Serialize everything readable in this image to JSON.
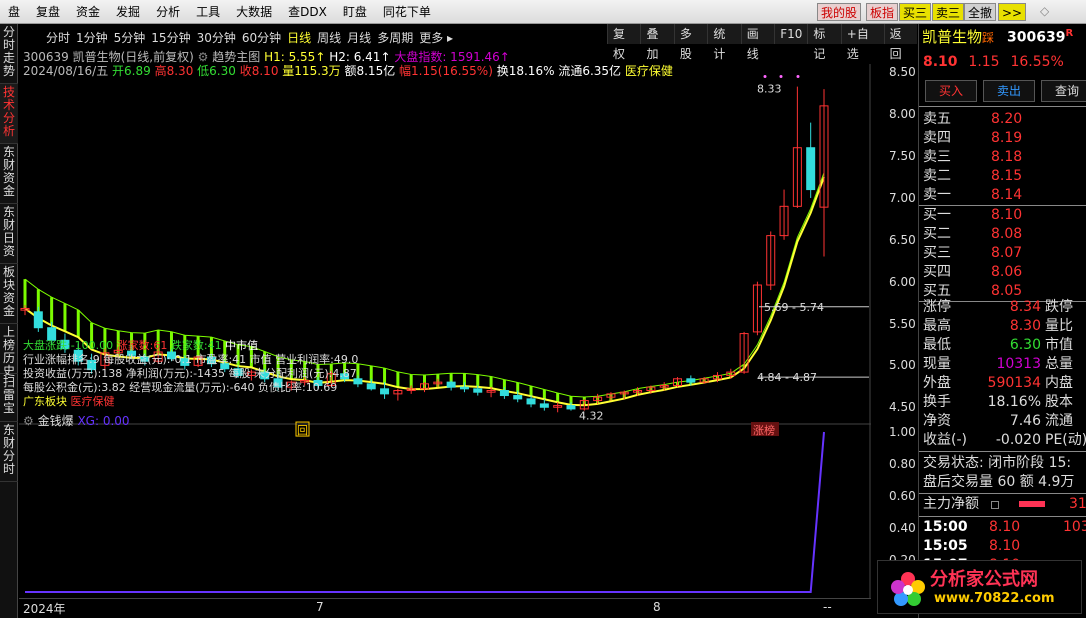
{
  "menubar": {
    "items": [
      "盘",
      "复盘",
      "资金",
      "发掘",
      "分析",
      "工具",
      "大数据",
      "查DDX",
      "盯盘",
      "同花下单"
    ],
    "quick": [
      "我的股",
      "板指",
      "买三",
      "卖三",
      "全撤",
      ">>"
    ]
  },
  "left_tabs": [
    "分时走势",
    "技术分析",
    "东财资金",
    "东财日资",
    "板块资金",
    "上榜历史",
    "扫雷宝",
    "东财分时"
  ],
  "chart_toolbar": [
    "复权",
    "叠加",
    "多股",
    "统计",
    "画线",
    "F10",
    "标记",
    "+自选",
    "返回"
  ],
  "periods": [
    "分时",
    "1分钟",
    "5分钟",
    "15分钟",
    "30分钟",
    "60分钟",
    "日线",
    "周线",
    "月线",
    "多周期",
    "更多 ▸"
  ],
  "active_period": "日线",
  "stock_title": {
    "code_name": "300639 凯普生物(日线,前复权)",
    "indicator": "趋势主图",
    "h1": "H1: 5.55↑",
    "h2": "H2: 6.41↑",
    "index": "大盘指数: 1591.46↑"
  },
  "stock_info": {
    "date": "2024/08/16/五",
    "open": "开6.89",
    "high": "高8.30",
    "low": "低6.30",
    "close": "收8.10",
    "vol": "量115.3万",
    "amount": "额8.15亿",
    "change": "幅1.15(16.55%)",
    "turnover": "换18.16%",
    "float": "流通6.35亿",
    "sector": "医疗保健"
  },
  "overlay": {
    "line1": "大盘涨跌:-100.00",
    "line1b": "涨家数:61",
    "line1c": "跌家数:41",
    "line1d": "中市值",
    "line2": "行业涨幅排名:9 每股收益(元):-0.1 市盈率:41 市值 营业利润率:49.0",
    "line3": "投资收益(万元):138 净利润(万元):-1435 每股 未分配利润(元):4.87",
    "line4": "每股公积金(元):3.82 经营现金流量(万元):-640 负债比率:10.69",
    "line5": "广东板块",
    "line5b": "医疗保健"
  },
  "annotations": {
    "high_label": "8.33",
    "mid_label": "5.69 - 5.74",
    "low_label": "4.84 - 4.87",
    "min_label": "4.32",
    "zt_label": "涨榜",
    "hui_label": "回"
  },
  "price_axis": [
    "8.50",
    "8.00",
    "7.50",
    "7.00",
    "6.50",
    "6.00",
    "5.50",
    "5.00",
    "4.50"
  ],
  "sub_chart": {
    "name": "金钱爆",
    "value": "XG: 0.00",
    "axis": [
      "1.00",
      "0.80",
      "0.60",
      "0.40",
      "0.20"
    ]
  },
  "time_axis": [
    "2024年",
    "7",
    "8",
    "--"
  ],
  "right_panel": {
    "name": "凯普生物",
    "tag": "踩",
    "code": "300639",
    "code_tag": "R",
    "price": "8.10",
    "change": "1.15",
    "pct": "16.55%",
    "buttons": [
      "买入",
      "卖出",
      "查询"
    ],
    "sells": [
      {
        "label": "卖五",
        "price": "8.20"
      },
      {
        "label": "卖四",
        "price": "8.19"
      },
      {
        "label": "卖三",
        "price": "8.18"
      },
      {
        "label": "卖二",
        "price": "8.15"
      },
      {
        "label": "卖一",
        "price": "8.14"
      }
    ],
    "buys": [
      {
        "label": "买一",
        "price": "8.10"
      },
      {
        "label": "买二",
        "price": "8.08"
      },
      {
        "label": "买三",
        "price": "8.07"
      },
      {
        "label": "买四",
        "price": "8.06"
      },
      {
        "label": "买五",
        "price": "8.05"
      }
    ],
    "stats": [
      {
        "l": "涨停",
        "v": "8.34",
        "c": "#ff3333",
        "l2": "跌停"
      },
      {
        "l": "最高",
        "v": "8.30",
        "c": "#ff3333",
        "l2": "量比"
      },
      {
        "l": "最低",
        "v": "6.30",
        "c": "#33dd33",
        "l2": "市值"
      },
      {
        "l": "现量",
        "v": "10313",
        "c": "#d000d0",
        "l2": "总量"
      },
      {
        "l": "外盘",
        "v": "590134",
        "c": "#ff3333",
        "l2": "内盘"
      },
      {
        "l": "换手",
        "v": "18.16%",
        "c": "#ddd",
        "l2": "股本"
      },
      {
        "l": "净资",
        "v": "7.46",
        "c": "#ddd",
        "l2": "流通"
      },
      {
        "l": "收益(-)",
        "v": "-0.020",
        "c": "#ddd",
        "l2": "PE(动)"
      }
    ],
    "trade_state": "交易状态: 闭市阶段 15:",
    "after_trade": "盘后交易量 60 额 4.9万",
    "main_flow": "主力净额",
    "main_flow_val": "31",
    "ticks": [
      {
        "t": "15:00",
        "p": "8.10",
        "v": "103"
      },
      {
        "t": "15:05",
        "p": "8.10",
        "v": ""
      },
      {
        "t": "15:07",
        "p": "8.10",
        "v": ""
      }
    ]
  },
  "watermark": {
    "title": "分析家公式网",
    "url": "www.70822.com"
  },
  "colors": {
    "up": "#ff3333",
    "down": "#33dddd",
    "ma_yellow": "#ffff33",
    "band_green": "#7cfc00",
    "sub_line": "#6633ff"
  },
  "chart_data": {
    "type": "candlestick",
    "ylim": [
      4.3,
      8.6
    ],
    "candles": [
      [
        5.66,
        5.72,
        5.6,
        5.68
      ],
      [
        5.64,
        5.7,
        5.4,
        5.45
      ],
      [
        5.45,
        5.52,
        5.25,
        5.3
      ],
      [
        5.3,
        5.38,
        5.15,
        5.2
      ],
      [
        5.18,
        5.26,
        5.0,
        5.05
      ],
      [
        5.06,
        5.14,
        4.9,
        4.95
      ],
      [
        5.0,
        5.2,
        4.95,
        5.15
      ],
      [
        5.15,
        5.22,
        5.1,
        5.18
      ],
      [
        5.17,
        5.24,
        5.08,
        5.12
      ],
      [
        5.1,
        5.14,
        5.0,
        5.05
      ],
      [
        5.05,
        5.2,
        5.02,
        5.16
      ],
      [
        5.16,
        5.2,
        5.05,
        5.08
      ],
      [
        5.08,
        5.12,
        4.95,
        5.0
      ],
      [
        5.0,
        5.12,
        4.98,
        5.1
      ],
      [
        5.1,
        5.14,
        4.98,
        5.02
      ],
      [
        5.02,
        5.06,
        4.92,
        4.96
      ],
      [
        4.96,
        5.0,
        4.85,
        4.88
      ],
      [
        4.88,
        4.95,
        4.82,
        4.92
      ],
      [
        4.92,
        4.96,
        4.8,
        4.84
      ],
      [
        4.84,
        4.9,
        4.7,
        4.74
      ],
      [
        4.74,
        4.82,
        4.7,
        4.8
      ],
      [
        4.8,
        4.86,
        4.76,
        4.82
      ],
      [
        4.82,
        4.86,
        4.72,
        4.76
      ],
      [
        4.76,
        4.94,
        4.74,
        4.9
      ],
      [
        4.9,
        4.94,
        4.8,
        4.84
      ],
      [
        4.84,
        4.88,
        4.74,
        4.78
      ],
      [
        4.78,
        4.84,
        4.7,
        4.72
      ],
      [
        4.72,
        4.8,
        4.6,
        4.66
      ],
      [
        4.66,
        4.72,
        4.58,
        4.7
      ],
      [
        4.7,
        4.76,
        4.66,
        4.72
      ],
      [
        4.72,
        4.8,
        4.68,
        4.78
      ],
      [
        4.78,
        4.84,
        4.74,
        4.8
      ],
      [
        4.8,
        4.82,
        4.7,
        4.74
      ],
      [
        4.74,
        4.8,
        4.68,
        4.72
      ],
      [
        4.72,
        4.76,
        4.64,
        4.68
      ],
      [
        4.68,
        4.74,
        4.62,
        4.7
      ],
      [
        4.7,
        4.74,
        4.6,
        4.64
      ],
      [
        4.64,
        4.7,
        4.56,
        4.6
      ],
      [
        4.6,
        4.64,
        4.5,
        4.54
      ],
      [
        4.54,
        4.6,
        4.46,
        4.5
      ],
      [
        4.5,
        4.56,
        4.44,
        4.52
      ],
      [
        4.52,
        4.56,
        4.46,
        4.48
      ],
      [
        4.48,
        4.6,
        4.46,
        4.58
      ],
      [
        4.58,
        4.66,
        4.54,
        4.62
      ],
      [
        4.62,
        4.68,
        4.58,
        4.66
      ],
      [
        4.66,
        4.7,
        4.6,
        4.68
      ],
      [
        4.68,
        4.74,
        4.64,
        4.7
      ],
      [
        4.7,
        4.76,
        4.66,
        4.74
      ],
      [
        4.74,
        4.8,
        4.7,
        4.76
      ],
      [
        4.76,
        4.86,
        4.74,
        4.84
      ],
      [
        4.84,
        4.88,
        4.76,
        4.8
      ],
      [
        4.8,
        4.86,
        4.78,
        4.84
      ],
      [
        4.84,
        4.92,
        4.8,
        4.88
      ],
      [
        4.88,
        4.96,
        4.84,
        4.92
      ],
      [
        4.92,
        5.4,
        4.9,
        5.38
      ],
      [
        5.4,
        6.0,
        5.36,
        5.96
      ],
      [
        5.96,
        6.6,
        5.9,
        6.55
      ],
      [
        6.55,
        7.1,
        6.5,
        6.9
      ],
      [
        6.9,
        8.33,
        6.88,
        7.6
      ],
      [
        7.6,
        7.9,
        7.0,
        7.1
      ],
      [
        6.89,
        8.3,
        6.3,
        8.1
      ]
    ],
    "sub_series": [
      0,
      0,
      0,
      0,
      0,
      0,
      0,
      0,
      0,
      0,
      0,
      0,
      0,
      0,
      0,
      0,
      0,
      0,
      0,
      0,
      0,
      0,
      0,
      0,
      0,
      0,
      0,
      0,
      0,
      0,
      0,
      0,
      0,
      0,
      0,
      0,
      0,
      0,
      0,
      0,
      0,
      0,
      0,
      0,
      0,
      0,
      0,
      0,
      0,
      0,
      0,
      0,
      0,
      0,
      0,
      0,
      0,
      0,
      0,
      0,
      1
    ]
  }
}
